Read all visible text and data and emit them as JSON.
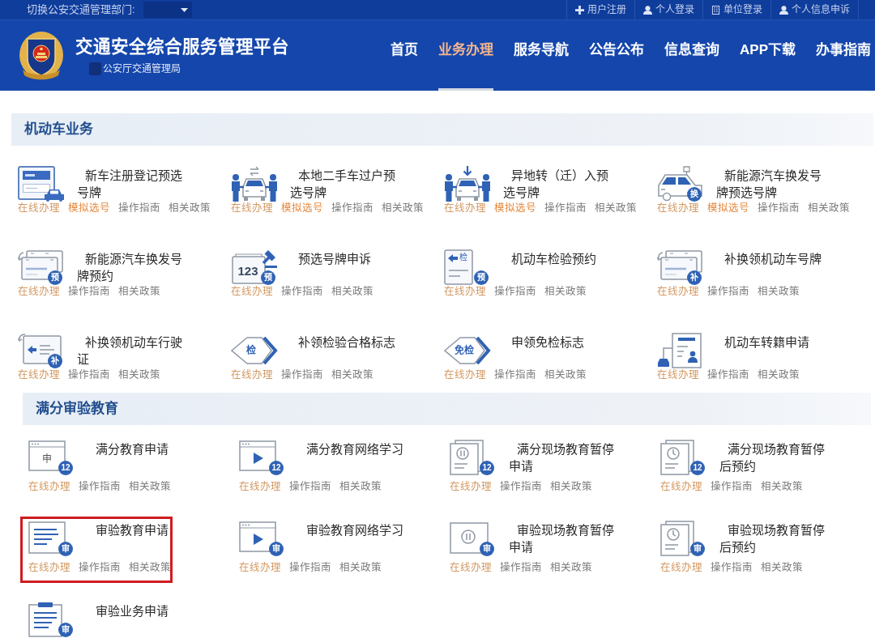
{
  "topbar": {
    "label": "切换公安交通管理部门:",
    "links": [
      {
        "kind": "plus",
        "label": "用户注册"
      },
      {
        "kind": "person",
        "label": "个人登录"
      },
      {
        "kind": "building",
        "label": "单位登录"
      },
      {
        "kind": "person",
        "label": "个人信息申诉"
      }
    ]
  },
  "header": {
    "title": "交通安全综合服务管理平台",
    "subtitle": "公安厅交通管理局",
    "nav": [
      {
        "label": "首页",
        "selected": false
      },
      {
        "label": "业务办理",
        "selected": true
      },
      {
        "label": "服务导航",
        "selected": false
      },
      {
        "label": "公告公布",
        "selected": false
      },
      {
        "label": "信息查询",
        "selected": false
      },
      {
        "label": "APP下载",
        "selected": false
      },
      {
        "label": "办事指南",
        "selected": false
      }
    ]
  },
  "sections": [
    {
      "title": "机动车业务",
      "items": [
        {
          "title": "新车注册登记预选号牌",
          "icon": {
            "kind": "plate-car"
          },
          "highlighted": false,
          "actions": [
            {
              "kind": "online",
              "label": "在线办理"
            },
            {
              "kind": "simulate",
              "label": "模拟选号"
            },
            {
              "kind": "guide",
              "label": "操作指南"
            },
            {
              "kind": "policy",
              "label": "相关政策"
            }
          ]
        },
        {
          "title": "本地二手车过户预选号牌",
          "icon": {
            "kind": "handover"
          },
          "highlighted": false,
          "actions": [
            {
              "kind": "online",
              "label": "在线办理"
            },
            {
              "kind": "simulate",
              "label": "模拟选号"
            },
            {
              "kind": "guide",
              "label": "操作指南"
            },
            {
              "kind": "policy",
              "label": "相关政策"
            }
          ]
        },
        {
          "title": "异地转（迁）入预选号牌",
          "icon": {
            "kind": "arrival"
          },
          "highlighted": false,
          "actions": [
            {
              "kind": "online",
              "label": "在线办理"
            },
            {
              "kind": "simulate",
              "label": "模拟选号"
            },
            {
              "kind": "guide",
              "label": "操作指南"
            },
            {
              "kind": "policy",
              "label": "相关政策"
            }
          ]
        },
        {
          "title": "新能源汽车换发号牌预选号牌",
          "icon": {
            "kind": "ev-car",
            "badge": "换"
          },
          "highlighted": false,
          "actions": [
            {
              "kind": "online",
              "label": "在线办理"
            },
            {
              "kind": "simulate",
              "label": "模拟选号"
            },
            {
              "kind": "guide",
              "label": "操作指南"
            },
            {
              "kind": "policy",
              "label": "相关政策"
            }
          ]
        },
        {
          "title": "新能源汽车换发号牌预约",
          "icon": {
            "kind": "plate-stack",
            "badge": "预"
          },
          "highlighted": false,
          "actions": [
            {
              "kind": "online",
              "label": "在线办理"
            },
            {
              "kind": "guide",
              "label": "操作指南"
            },
            {
              "kind": "policy",
              "label": "相关政策"
            }
          ]
        },
        {
          "title": "预选号牌申诉",
          "icon": {
            "kind": "plate-gavel",
            "text": "123",
            "badge": "预"
          },
          "highlighted": false,
          "actions": [
            {
              "kind": "online",
              "label": "在线办理"
            },
            {
              "kind": "guide",
              "label": "操作指南"
            },
            {
              "kind": "policy",
              "label": "相关政策"
            }
          ]
        },
        {
          "title": "机动车检验预约",
          "icon": {
            "kind": "doc-check",
            "text": "检",
            "badge": "预"
          },
          "highlighted": false,
          "actions": [
            {
              "kind": "online",
              "label": "在线办理"
            },
            {
              "kind": "guide",
              "label": "操作指南"
            },
            {
              "kind": "policy",
              "label": "相关政策"
            }
          ]
        },
        {
          "title": "补换领机动车号牌",
          "icon": {
            "kind": "plate-stack",
            "badge": "补"
          },
          "highlighted": false,
          "actions": [
            {
              "kind": "online",
              "label": "在线办理"
            },
            {
              "kind": "guide",
              "label": "操作指南"
            },
            {
              "kind": "policy",
              "label": "相关政策"
            }
          ]
        },
        {
          "title": "补换领机动车行驶证",
          "icon": {
            "kind": "license-card",
            "badge": "补"
          },
          "highlighted": false,
          "actions": [
            {
              "kind": "online",
              "label": "在线办理"
            },
            {
              "kind": "guide",
              "label": "操作指南"
            },
            {
              "kind": "policy",
              "label": "相关政策"
            }
          ]
        },
        {
          "title": "补领检验合格标志",
          "icon": {
            "kind": "diamond",
            "text": "检"
          },
          "highlighted": false,
          "actions": [
            {
              "kind": "online",
              "label": "在线办理"
            },
            {
              "kind": "guide",
              "label": "操作指南"
            },
            {
              "kind": "policy",
              "label": "相关政策"
            }
          ]
        },
        {
          "title": "申领免检标志",
          "icon": {
            "kind": "diamond",
            "text": "免检"
          },
          "highlighted": false,
          "actions": [
            {
              "kind": "online",
              "label": "在线办理"
            },
            {
              "kind": "guide",
              "label": "操作指南"
            },
            {
              "kind": "policy",
              "label": "相关政策"
            }
          ]
        },
        {
          "title": "机动车转籍申请",
          "icon": {
            "kind": "transfer-doc"
          },
          "highlighted": false,
          "actions": [
            {
              "kind": "online",
              "label": "在线办理"
            },
            {
              "kind": "guide",
              "label": "操作指南"
            },
            {
              "kind": "policy",
              "label": "相关政策"
            }
          ]
        }
      ]
    },
    {
      "title": "满分审验教育",
      "items": [
        {
          "title": "满分教育申请",
          "icon": {
            "kind": "window",
            "text": "申",
            "badge": "12"
          },
          "highlighted": false,
          "actions": [
            {
              "kind": "online",
              "label": "在线办理"
            },
            {
              "kind": "guide",
              "label": "操作指南"
            },
            {
              "kind": "policy",
              "label": "相关政策"
            }
          ]
        },
        {
          "title": "满分教育网络学习",
          "icon": {
            "kind": "window-play",
            "badge": "12"
          },
          "highlighted": false,
          "actions": [
            {
              "kind": "online",
              "label": "在线办理"
            },
            {
              "kind": "guide",
              "label": "操作指南"
            },
            {
              "kind": "policy",
              "label": "相关政策"
            }
          ]
        },
        {
          "title": "满分现场教育暂停申请",
          "icon": {
            "kind": "pause-stack",
            "badge": "12"
          },
          "highlighted": false,
          "actions": [
            {
              "kind": "online",
              "label": "在线办理"
            },
            {
              "kind": "guide",
              "label": "操作指南"
            },
            {
              "kind": "policy",
              "label": "相关政策"
            }
          ]
        },
        {
          "title": "满分现场教育暂停后预约",
          "icon": {
            "kind": "clock-stack",
            "badge": "12"
          },
          "highlighted": false,
          "actions": [
            {
              "kind": "online",
              "label": "在线办理"
            },
            {
              "kind": "guide",
              "label": "操作指南"
            },
            {
              "kind": "policy",
              "label": "相关政策"
            }
          ]
        },
        {
          "title": "审验教育申请",
          "icon": {
            "kind": "window-lines",
            "badge": "审"
          },
          "highlighted": true,
          "actions": [
            {
              "kind": "online",
              "label": "在线办理"
            },
            {
              "kind": "guide",
              "label": "操作指南"
            },
            {
              "kind": "policy",
              "label": "相关政策"
            }
          ]
        },
        {
          "title": "审验教育网络学习",
          "icon": {
            "kind": "window-play",
            "badge": "审"
          },
          "highlighted": false,
          "actions": [
            {
              "kind": "online",
              "label": "在线办理"
            },
            {
              "kind": "guide",
              "label": "操作指南"
            },
            {
              "kind": "policy",
              "label": "相关政策"
            }
          ]
        },
        {
          "title": "审验现场教育暂停申请",
          "icon": {
            "kind": "pause-window",
            "badge": "审"
          },
          "highlighted": false,
          "actions": [
            {
              "kind": "online",
              "label": "在线办理"
            },
            {
              "kind": "guide",
              "label": "操作指南"
            },
            {
              "kind": "policy",
              "label": "相关政策"
            }
          ]
        },
        {
          "title": "审验现场教育暂停后预约",
          "icon": {
            "kind": "clock-stack",
            "badge": "审"
          },
          "highlighted": false,
          "actions": [
            {
              "kind": "online",
              "label": "在线办理"
            },
            {
              "kind": "guide",
              "label": "操作指南"
            },
            {
              "kind": "policy",
              "label": "相关政策"
            }
          ]
        },
        {
          "title": "审验业务申请",
          "icon": {
            "kind": "clipboard",
            "badge": "审"
          },
          "highlighted": false
        }
      ]
    }
  ]
}
